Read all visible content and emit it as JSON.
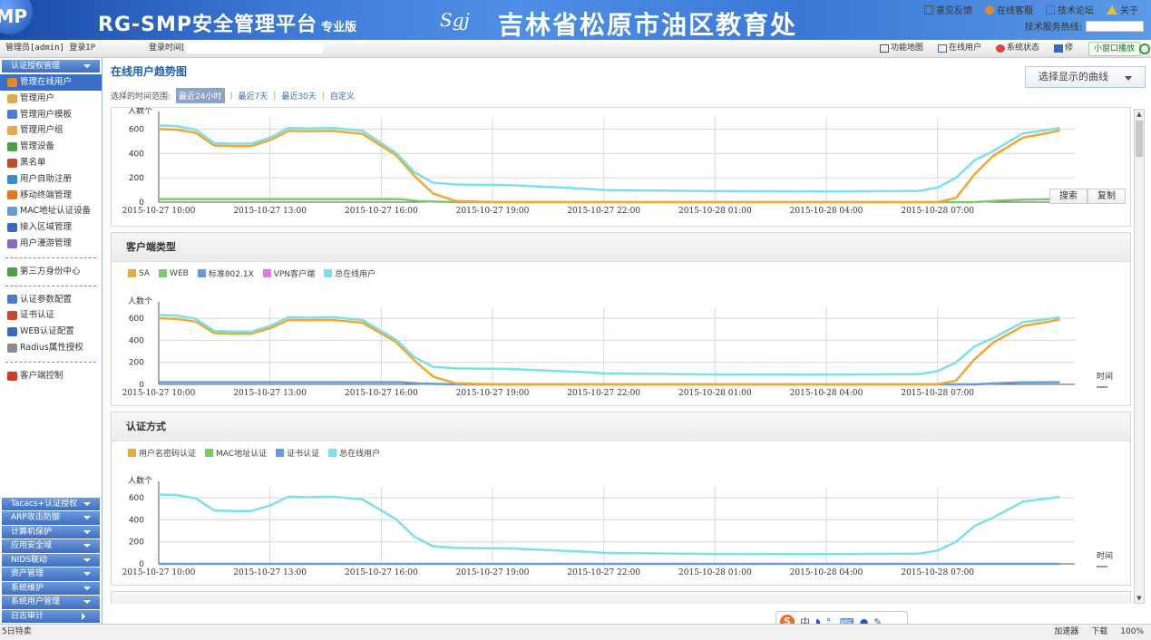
{
  "header": {
    "logo_text": "MP",
    "product": "RG-SMP安全管理平台",
    "edition": "专业版",
    "org_mark": "Sgj",
    "org": "吉林省松原市油区教育处",
    "links": [
      "意见反馈",
      "在线客服",
      "技术论坛",
      "关于"
    ],
    "hotline_label": "技术服务热线:"
  },
  "infobar": {
    "admin": "管理员[admin] 登录IP",
    "login_time_label": "登录时间[",
    "nav": [
      "功能地图",
      "在线用户",
      "系统状态",
      "修"
    ],
    "small_window": "小窗口播放"
  },
  "sidebar": {
    "top_section": "认证授权管理",
    "items": [
      {
        "label": "管理在线用户",
        "color": "#e08a2a"
      },
      {
        "label": "管理用户",
        "color": "#e6a84a"
      },
      {
        "label": "管理用户模板",
        "color": "#4a7ad0"
      },
      {
        "label": "管理用户组",
        "color": "#e6a84a"
      },
      {
        "label": "管理设备",
        "color": "#4aa04a"
      },
      {
        "label": "黑名单",
        "color": "#c04a2a"
      },
      {
        "label": "用户自助注册",
        "color": "#3a8ad0"
      },
      {
        "label": "移动终端管理",
        "color": "#e07a2a"
      },
      {
        "label": "MAC地址认证设备",
        "color": "#6a9ad0"
      },
      {
        "label": "接入区域管理",
        "color": "#3a6ac0"
      },
      {
        "label": "用户漫游管理",
        "color": "#8a6ac0"
      }
    ],
    "group2": [
      {
        "label": "第三方身份中心",
        "color": "#4aa04a"
      }
    ],
    "group3": [
      {
        "label": "认证参数配置",
        "color": "#4a7ad0"
      },
      {
        "label": "证书认证",
        "color": "#c04a2a"
      },
      {
        "label": "WEB认证配置",
        "color": "#3a6ac0"
      },
      {
        "label": "Radius属性授权",
        "color": "#8a8a8a"
      }
    ],
    "group4": [
      {
        "label": "客户端控制",
        "color": "#d03a2a"
      }
    ],
    "bottom_sections": [
      "Tacacs+认证授权",
      "ARP攻击防御",
      "计算机保护",
      "应用安全域",
      "NIDS联动",
      "资产管理",
      "系统维护",
      "系统用户管理",
      "日志审计"
    ]
  },
  "main": {
    "title": "在线用户趋势图",
    "range_label": "选择的时间范围:",
    "range_options": [
      "最近24小时",
      "最近7天",
      "最近30天",
      "自定义"
    ],
    "curve_button": "选择显示的曲线",
    "tool_buttons": [
      "搜索",
      "复制"
    ],
    "x_axis_label": "时间",
    "y_axis_label": "人数个",
    "panel_titles": [
      "客户端类型",
      "认证方式"
    ],
    "legend_client": [
      {
        "name": "SA",
        "color": "#f0a830"
      },
      {
        "name": "WEB",
        "color": "#7cc86a"
      },
      {
        "name": "标准802.1X",
        "color": "#6a9ad8"
      },
      {
        "name": "VPN客户端",
        "color": "#e07ae0"
      },
      {
        "name": "总在线用户",
        "color": "#7ae0ec"
      }
    ],
    "legend_auth": [
      {
        "name": "用户名密码认证",
        "color": "#f0a830"
      },
      {
        "name": "MAC地址认证",
        "color": "#7cc86a"
      },
      {
        "name": "证书认证",
        "color": "#6a9ad8"
      },
      {
        "name": "总在线用户",
        "color": "#7ae0ec"
      }
    ]
  },
  "chart_data": [
    {
      "type": "line",
      "title": "在线用户趋势图",
      "ylabel": "人数个",
      "ylim": [
        0,
        700
      ],
      "yticks": [
        0,
        200,
        400,
        600
      ],
      "x": [
        "2015-10-27 10:00",
        "2015-10-27 13:00",
        "2015-10-27 16:00",
        "2015-10-27 19:00",
        "2015-10-27 22:00",
        "2015-10-28 01:00",
        "2015-10-28 04:00",
        "2015-10-28 07:00"
      ],
      "series": [
        {
          "name": "总在线用户",
          "color": "#7ae0ec",
          "points": [
            [
              0,
              630
            ],
            [
              0.5,
              625
            ],
            [
              1,
              595
            ],
            [
              1.5,
              485
            ],
            [
              2,
              480
            ],
            [
              2.5,
              480
            ],
            [
              3,
              530
            ],
            [
              3.5,
              610
            ],
            [
              4,
              605
            ],
            [
              4.7,
              610
            ],
            [
              5.5,
              585
            ],
            [
              6.4,
              405
            ],
            [
              6.9,
              245
            ],
            [
              7.4,
              160
            ],
            [
              8,
              145
            ],
            [
              9.5,
              140
            ],
            [
              10,
              132
            ],
            [
              11.5,
              110
            ],
            [
              12,
              100
            ],
            [
              13.5,
              95
            ],
            [
              15,
              90
            ],
            [
              18,
              88
            ],
            [
              20.5,
              92
            ],
            [
              21,
              120
            ],
            [
              21.5,
              200
            ],
            [
              22,
              345
            ],
            [
              22.5,
              420
            ],
            [
              23.3,
              565
            ],
            [
              24,
              595
            ],
            [
              24.3,
              610
            ]
          ]
        },
        {
          "name": "SA",
          "color": "#f0a830",
          "points": [
            [
              0,
              600
            ],
            [
              0.5,
              595
            ],
            [
              1,
              570
            ],
            [
              1.5,
              465
            ],
            [
              2,
              460
            ],
            [
              2.5,
              460
            ],
            [
              3,
              510
            ],
            [
              3.5,
              585
            ],
            [
              4,
              582
            ],
            [
              4.7,
              585
            ],
            [
              5.5,
              560
            ],
            [
              6.4,
              385
            ],
            [
              6.9,
              215
            ],
            [
              7.4,
              70
            ],
            [
              8,
              10
            ],
            [
              9,
              0
            ],
            [
              21,
              0
            ],
            [
              21.5,
              35
            ],
            [
              22,
              230
            ],
            [
              22.5,
              380
            ],
            [
              23.3,
              530
            ],
            [
              24,
              570
            ],
            [
              24.3,
              590
            ]
          ]
        },
        {
          "name": "WEB",
          "color": "#7cc86a",
          "points": [
            [
              0,
              25
            ],
            [
              5,
              25
            ],
            [
              6.5,
              25
            ],
            [
              7,
              8
            ],
            [
              8,
              0
            ],
            [
              22,
              0
            ],
            [
              22.5,
              10
            ],
            [
              23.3,
              20
            ],
            [
              24.3,
              25
            ]
          ]
        }
      ]
    },
    {
      "type": "line",
      "title": "客户端类型",
      "ylabel": "人数个",
      "ylim": [
        0,
        700
      ],
      "yticks": [
        0,
        200,
        400,
        600
      ],
      "x": [
        "2015-10-27 10:00",
        "2015-10-27 13:00",
        "2015-10-27 16:00",
        "2015-10-27 19:00",
        "2015-10-27 22:00",
        "2015-10-28 01:00",
        "2015-10-28 04:00",
        "2015-10-28 07:00"
      ],
      "series": [
        {
          "name": "总在线用户",
          "color": "#7ae0ec",
          "points": [
            [
              0,
              630
            ],
            [
              0.5,
              625
            ],
            [
              1,
              595
            ],
            [
              1.5,
              485
            ],
            [
              2,
              480
            ],
            [
              2.5,
              480
            ],
            [
              3,
              530
            ],
            [
              3.5,
              610
            ],
            [
              4,
              605
            ],
            [
              4.7,
              610
            ],
            [
              5.5,
              585
            ],
            [
              6.4,
              405
            ],
            [
              6.9,
              245
            ],
            [
              7.4,
              160
            ],
            [
              8,
              145
            ],
            [
              9.5,
              140
            ],
            [
              10,
              132
            ],
            [
              11.5,
              110
            ],
            [
              12,
              100
            ],
            [
              13.5,
              95
            ],
            [
              15,
              90
            ],
            [
              18,
              88
            ],
            [
              20.5,
              92
            ],
            [
              21,
              120
            ],
            [
              21.5,
              200
            ],
            [
              22,
              345
            ],
            [
              22.5,
              420
            ],
            [
              23.3,
              565
            ],
            [
              24,
              595
            ],
            [
              24.3,
              610
            ]
          ]
        },
        {
          "name": "SA",
          "color": "#f0a830",
          "points": [
            [
              0,
              600
            ],
            [
              0.5,
              595
            ],
            [
              1,
              570
            ],
            [
              1.5,
              465
            ],
            [
              2,
              460
            ],
            [
              2.5,
              460
            ],
            [
              3,
              510
            ],
            [
              3.5,
              585
            ],
            [
              4,
              582
            ],
            [
              4.7,
              585
            ],
            [
              5.5,
              560
            ],
            [
              6.4,
              385
            ],
            [
              6.9,
              215
            ],
            [
              7.4,
              70
            ],
            [
              8,
              10
            ],
            [
              9,
              0
            ],
            [
              21,
              0
            ],
            [
              21.5,
              35
            ],
            [
              22,
              230
            ],
            [
              22.5,
              380
            ],
            [
              23.3,
              530
            ],
            [
              24,
              570
            ],
            [
              24.3,
              590
            ]
          ]
        },
        {
          "name": "标准802.1X",
          "color": "#6a9ad8",
          "points": [
            [
              0,
              20
            ],
            [
              5,
              20
            ],
            [
              6.5,
              20
            ],
            [
              7,
              8
            ],
            [
              8,
              0
            ],
            [
              22,
              0
            ],
            [
              22.5,
              8
            ],
            [
              23.3,
              18
            ],
            [
              24.3,
              20
            ]
          ]
        }
      ]
    },
    {
      "type": "line",
      "title": "认证方式",
      "ylabel": "人数个",
      "ylim": [
        0,
        700
      ],
      "yticks": [
        0,
        200,
        400,
        600
      ],
      "x": [
        "2015-10-27 10:00",
        "2015-10-27 13:00",
        "2015-10-27 16:00",
        "2015-10-27 19:00",
        "2015-10-27 22:00",
        "2015-10-28 01:00",
        "2015-10-28 04:00",
        "2015-10-28 07:00"
      ],
      "series": [
        {
          "name": "总在线用户",
          "color": "#7ae0ec",
          "points": [
            [
              0,
              630
            ],
            [
              0.5,
              625
            ],
            [
              1,
              595
            ],
            [
              1.5,
              485
            ],
            [
              2,
              480
            ],
            [
              2.5,
              480
            ],
            [
              3,
              530
            ],
            [
              3.5,
              610
            ],
            [
              4,
              605
            ],
            [
              4.7,
              610
            ],
            [
              5.5,
              585
            ],
            [
              6.4,
              405
            ],
            [
              6.9,
              245
            ],
            [
              7.4,
              160
            ],
            [
              8,
              145
            ],
            [
              9.5,
              140
            ],
            [
              10,
              132
            ],
            [
              11.5,
              110
            ],
            [
              12,
              100
            ],
            [
              13.5,
              95
            ],
            [
              15,
              90
            ],
            [
              18,
              88
            ],
            [
              20.5,
              92
            ],
            [
              21,
              120
            ],
            [
              21.5,
              200
            ],
            [
              22,
              345
            ],
            [
              22.5,
              420
            ],
            [
              23.3,
              565
            ],
            [
              24,
              595
            ],
            [
              24.3,
              610
            ]
          ]
        },
        {
          "name": "证书认证",
          "color": "#6a9ad8",
          "points": [
            [
              0,
              0
            ],
            [
              24.3,
              0
            ]
          ]
        }
      ]
    }
  ],
  "statusbar": {
    "left": "5日特卖",
    "right": [
      "加速器",
      "下载",
      "100%"
    ]
  },
  "ime": {
    "label": "中"
  }
}
